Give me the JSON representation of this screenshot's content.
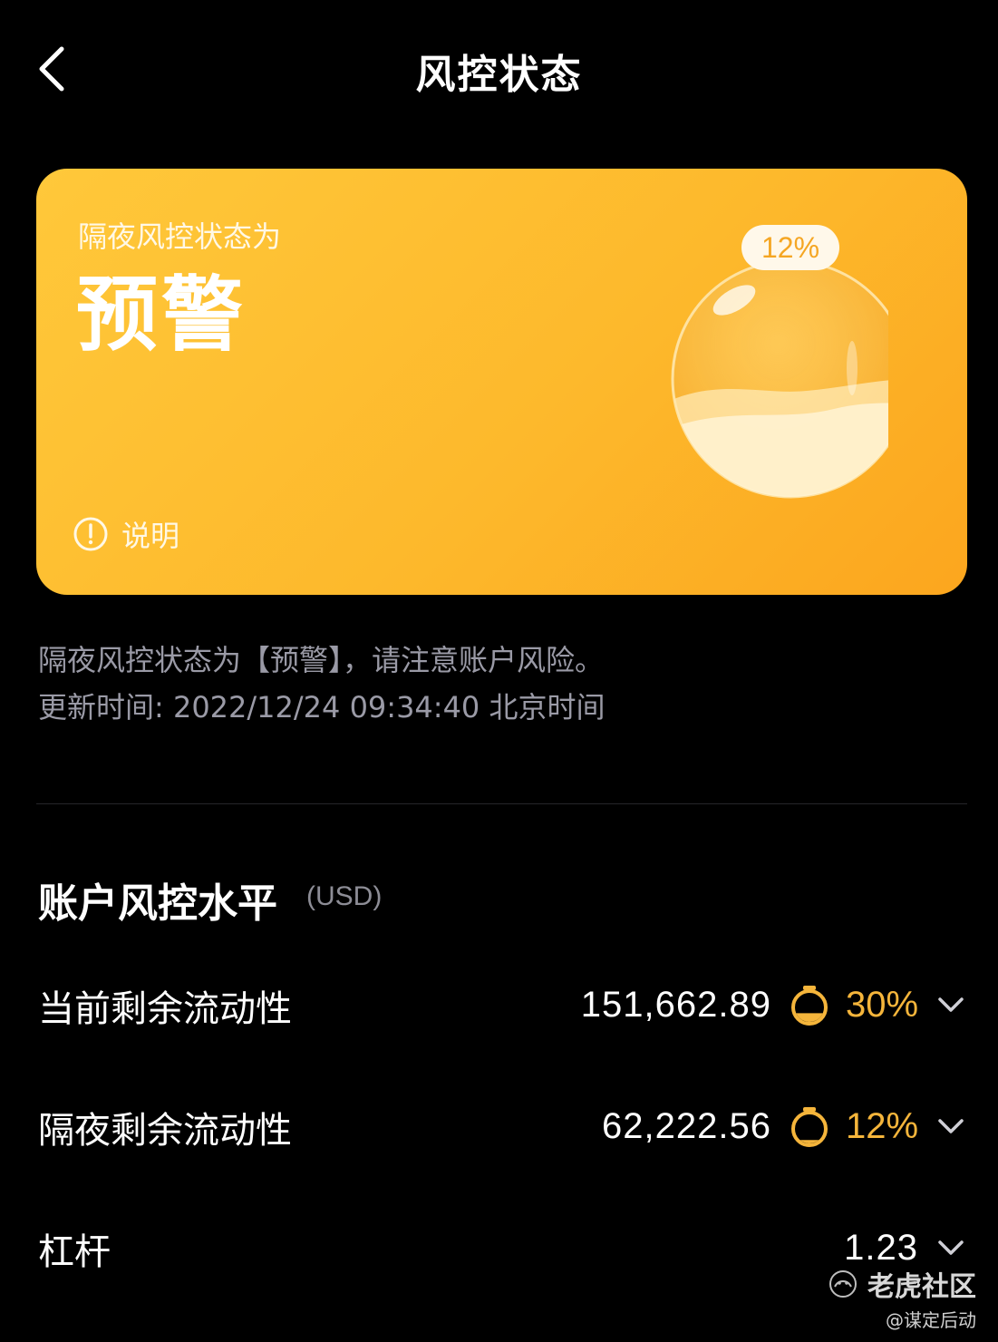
{
  "nav": {
    "title": "风控状态",
    "back_icon": "chevron-left-icon"
  },
  "card": {
    "label": "隔夜风控状态为",
    "status": "预警",
    "badge": "12%",
    "fill_fraction": 0.12,
    "help_label": "说明",
    "colors": {
      "top": "#ffc83a",
      "bottom": "#fca61e"
    }
  },
  "notice": {
    "line1": "隔夜风控状态为【预警】，请注意账户风险。",
    "line2": "更新时间: 2022/12/24 09:34:40 北京时间"
  },
  "section": {
    "title": "账户风控水平",
    "unit": "(USD)"
  },
  "rows": [
    {
      "label": "当前剩余流动性",
      "value": "151,662.89",
      "percent": "30%",
      "level": 0.3
    },
    {
      "label": "隔夜剩余流动性",
      "value": "62,222.56",
      "percent": "12%",
      "level": 0.12
    },
    {
      "label": "杠杆",
      "value": "1.23",
      "percent": ""
    }
  ],
  "watermark": {
    "text": "老虎社区",
    "sub": "@谋定后动"
  },
  "accent_color": "#f5b53b"
}
